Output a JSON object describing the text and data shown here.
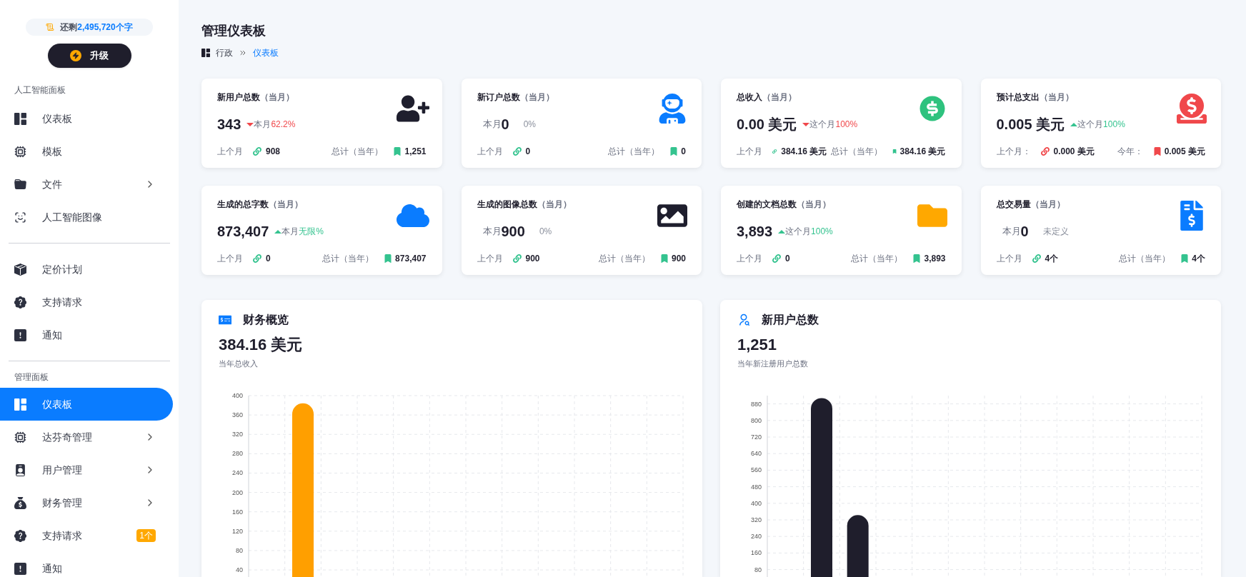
{
  "sidebar": {
    "credits": {
      "prefix": "还剩",
      "amount": "2,495,720个字"
    },
    "upgrade_button": "升级",
    "sections": [
      {
        "title": "人工智能面板",
        "items": [
          {
            "label": "仪表板",
            "selected": false,
            "has_children": false
          },
          {
            "label": "模板",
            "selected": false,
            "has_children": false
          },
          {
            "label": "文件",
            "selected": false,
            "has_children": true
          },
          {
            "label": "人工智能图像",
            "selected": false,
            "has_children": false
          }
        ]
      },
      {
        "items": [
          {
            "label": "定价计划",
            "selected": false,
            "has_children": false
          },
          {
            "label": "支持请求",
            "selected": false,
            "has_children": false
          },
          {
            "label": "通知",
            "selected": false,
            "has_children": false
          }
        ]
      },
      {
        "title": "管理面板",
        "items": [
          {
            "label": "仪表板",
            "selected": true,
            "has_children": false
          },
          {
            "label": "达芬奇管理",
            "selected": false,
            "has_children": true
          },
          {
            "label": "用户管理",
            "selected": false,
            "has_children": true
          },
          {
            "label": "财务管理",
            "selected": false,
            "has_children": true
          },
          {
            "label": "支持请求",
            "selected": false,
            "has_children": false,
            "badge": "1个"
          },
          {
            "label": "通知",
            "selected": false,
            "has_children": false
          }
        ]
      }
    ]
  },
  "page": {
    "title": "管理仪表板",
    "breadcrumb": [
      "行政",
      "仪表板"
    ]
  },
  "stats": [
    {
      "title": "新用户总数",
      "period": "（当月）",
      "color": "#1e1e2d",
      "value": "343",
      "trend": {
        "kind": "down",
        "label": "本月",
        "change": "62.2%"
      },
      "footer": {
        "kind": "green",
        "left_label": "上个月",
        "left_value": "908",
        "right_label": "总计（当年）",
        "right_value": "1,251"
      }
    },
    {
      "title": "新订户总数",
      "period": "（当月）",
      "color": "#0a7cff",
      "prefix": "本月",
      "value": "0",
      "trend": {
        "kind": "flat",
        "change": "0%"
      },
      "footer": {
        "kind": "green",
        "left_label": "上个月",
        "left_value": "0",
        "right_label": "总计（当年）",
        "right_value": "0"
      }
    },
    {
      "title": "总收入",
      "period": "（当月）",
      "color": "#2ec27e",
      "value": "0.00 美元",
      "trend": {
        "kind": "down",
        "label": "这个月",
        "change": "100%"
      },
      "footer": {
        "kind": "green",
        "left_label": "上个月",
        "left_value": "384.16 美元",
        "right_label": "总计（当年）",
        "right_value": "384.16 美元"
      }
    },
    {
      "title": "预计总支出",
      "period": "（当月）",
      "color": "#f0484b",
      "value": "0.005 美元",
      "trend": {
        "kind": "up",
        "label": "这个月",
        "change": "100%"
      },
      "footer": {
        "kind": "red",
        "left_label": "上个月：",
        "left_value": "0.000 美元",
        "right_label": "今年：",
        "right_value": "0.005 美元"
      }
    },
    {
      "title": "生成的总字数",
      "period": "（当月）",
      "color": "#0a7cff",
      "value": "873,407",
      "trend": {
        "kind": "up",
        "label": "本月",
        "change": "无限%"
      },
      "footer": {
        "kind": "green",
        "left_label": "上个月",
        "left_value": "0",
        "right_label": "总计（当年）",
        "right_value": "873,407"
      }
    },
    {
      "title": "生成的图像总数",
      "period": "（当月）",
      "color": "#1e1e2d",
      "prefix": "本月",
      "value": "900",
      "trend": {
        "kind": "flat",
        "change": "0%"
      },
      "footer": {
        "kind": "green",
        "left_label": "上个月",
        "left_value": "900",
        "right_label": "总计（当年）",
        "right_value": "900"
      }
    },
    {
      "title": "创建的文档总数",
      "period": "（当月）",
      "color": "#ffa800",
      "value": "3,893",
      "trend": {
        "kind": "up",
        "label": "这个月",
        "change": "100%"
      },
      "footer": {
        "kind": "green",
        "left_label": "上个月",
        "left_value": "0",
        "right_label": "总计（当年）",
        "right_value": "3,893"
      }
    },
    {
      "title": "总交易量",
      "period": "（当月）",
      "color": "#0a7cff",
      "prefix": "本月",
      "value": "0",
      "trend": {
        "kind": "flat",
        "change": "未定义"
      },
      "footer": {
        "kind": "green",
        "left_label": "上个月",
        "left_value": "4个",
        "right_label": "总计（当年）",
        "right_value": "4个"
      }
    }
  ],
  "panels": [
    {
      "title": "财务概览",
      "total": "384.16 美元",
      "caption": "当年总收入",
      "chart_data": {
        "type": "bar",
        "grid": true,
        "ylim": [
          0,
          400
        ],
        "yticks": [
          40,
          80,
          120,
          160,
          200,
          240,
          280,
          320,
          360,
          400
        ],
        "series": [
          {
            "color": "#ff9f00",
            "values": [
              0,
              384,
              0,
              0,
              0,
              0,
              0,
              0,
              0,
              0,
              0,
              0
            ]
          }
        ]
      }
    },
    {
      "title": "新用户总数",
      "total": "1,251",
      "caption": "当年新注册用户总数",
      "chart_data": {
        "type": "bar",
        "grid": true,
        "ylim": [
          0,
          920
        ],
        "yticks": [
          80,
          160,
          240,
          320,
          400,
          480,
          560,
          640,
          720,
          800,
          880
        ],
        "series": [
          {
            "color": "#1f1e2c",
            "values": [
              0,
              908,
              343,
              0,
              0,
              0,
              0,
              0,
              0,
              0,
              0,
              0
            ]
          }
        ]
      }
    }
  ]
}
